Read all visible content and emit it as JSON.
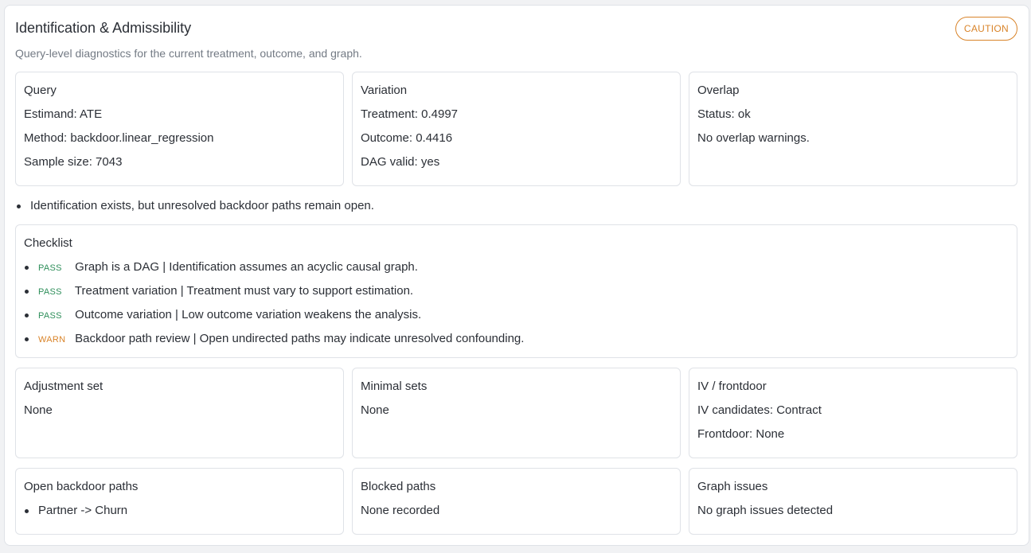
{
  "header": {
    "title": "Identification & Admissibility",
    "subtitle": "Query-level diagnostics for the current treatment, outcome, and graph.",
    "badge": "CAUTION"
  },
  "query": {
    "title": "Query",
    "estimand": "Estimand: ATE",
    "method": "Method: backdoor.linear_regression",
    "sample_size": "Sample size: 7043"
  },
  "variation": {
    "title": "Variation",
    "treatment": "Treatment: 0.4997",
    "outcome": "Outcome: 0.4416",
    "dag_valid": "DAG valid: yes"
  },
  "overlap": {
    "title": "Overlap",
    "status": "Status: ok",
    "message": "No overlap warnings."
  },
  "summary": "Identification exists, but unresolved backdoor paths remain open.",
  "checklist": {
    "title": "Checklist",
    "items": [
      {
        "status": "PASS",
        "text": "Graph is a DAG | Identification assumes an acyclic causal graph."
      },
      {
        "status": "PASS",
        "text": "Treatment variation | Treatment must vary to support estimation."
      },
      {
        "status": "PASS",
        "text": "Outcome variation | Low outcome variation weakens the analysis."
      },
      {
        "status": "WARN",
        "text": "Backdoor path review | Open undirected paths may indicate unresolved confounding."
      }
    ]
  },
  "adjustment": {
    "title": "Adjustment set",
    "value": "None"
  },
  "minimal": {
    "title": "Minimal sets",
    "value": "None"
  },
  "iv": {
    "title": "IV / frontdoor",
    "candidates": "IV candidates: Contract",
    "frontdoor": "Frontdoor: None"
  },
  "open_paths": {
    "title": "Open backdoor paths",
    "items": [
      "Partner -> Churn"
    ]
  },
  "blocked": {
    "title": "Blocked paths",
    "value": "None recorded"
  },
  "graph_issues": {
    "title": "Graph issues",
    "value": "No graph issues detected"
  },
  "colors": {
    "pass": "#2f8f5b",
    "warn": "#d9842a",
    "caution": "#d9842a"
  }
}
